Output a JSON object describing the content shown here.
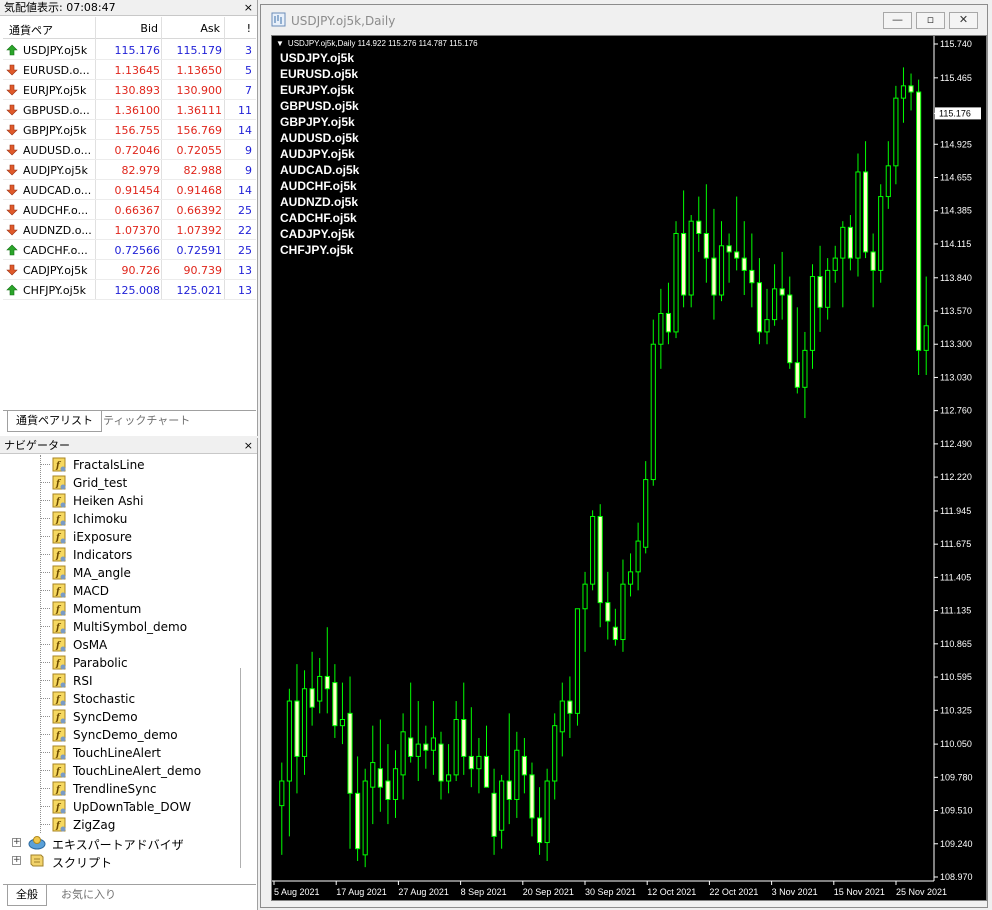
{
  "market_watch": {
    "title": "気配値表示: 07:08:47",
    "columns": {
      "symbol": "通貨ペア",
      "bid": "Bid",
      "ask": "Ask",
      "spread": "!"
    },
    "rows": [
      {
        "symbol": "USDJPY.oj5k",
        "bid": "115.176",
        "ask": "115.179",
        "spread": "3",
        "dir": "up"
      },
      {
        "symbol": "EURUSD.o...",
        "bid": "1.13645",
        "ask": "1.13650",
        "spread": "5",
        "dir": "down"
      },
      {
        "symbol": "EURJPY.oj5k",
        "bid": "130.893",
        "ask": "130.900",
        "spread": "7",
        "dir": "down"
      },
      {
        "symbol": "GBPUSD.o...",
        "bid": "1.36100",
        "ask": "1.36111",
        "spread": "11",
        "dir": "down"
      },
      {
        "symbol": "GBPJPY.oj5k",
        "bid": "156.755",
        "ask": "156.769",
        "spread": "14",
        "dir": "down"
      },
      {
        "symbol": "AUDUSD.o...",
        "bid": "0.72046",
        "ask": "0.72055",
        "spread": "9",
        "dir": "down"
      },
      {
        "symbol": "AUDJPY.oj5k",
        "bid": "82.979",
        "ask": "82.988",
        "spread": "9",
        "dir": "down"
      },
      {
        "symbol": "AUDCAD.o...",
        "bid": "0.91454",
        "ask": "0.91468",
        "spread": "14",
        "dir": "down"
      },
      {
        "symbol": "AUDCHF.o...",
        "bid": "0.66367",
        "ask": "0.66392",
        "spread": "25",
        "dir": "down"
      },
      {
        "symbol": "AUDNZD.o...",
        "bid": "1.07370",
        "ask": "1.07392",
        "spread": "22",
        "dir": "down"
      },
      {
        "symbol": "CADCHF.o...",
        "bid": "0.72566",
        "ask": "0.72591",
        "spread": "25",
        "dir": "up"
      },
      {
        "symbol": "CADJPY.oj5k",
        "bid": "90.726",
        "ask": "90.739",
        "spread": "13",
        "dir": "down"
      },
      {
        "symbol": "CHFJPY.oj5k",
        "bid": "125.008",
        "ask": "125.021",
        "spread": "13",
        "dir": "up"
      }
    ],
    "tabs": [
      "通貨ペアリスト",
      "ティックチャート"
    ]
  },
  "navigator": {
    "title": "ナビゲーター",
    "indicators": [
      "FractalsLine",
      "Grid_test",
      "Heiken Ashi",
      "Ichimoku",
      "iExposure",
      "Indicators",
      "MA_angle",
      "MACD",
      "Momentum",
      "MultiSymbol_demo",
      "OsMA",
      "Parabolic",
      "RSI",
      "Stochastic",
      "SyncDemo",
      "SyncDemo_demo",
      "TouchLineAlert",
      "TouchLineAlert_demo",
      "TrendlineSync",
      "UpDownTable_DOW",
      "ZigZag"
    ],
    "folders": [
      "エキスパートアドバイザ",
      "スクリプト"
    ],
    "tabs": [
      "全般",
      "お気に入り"
    ]
  },
  "chart_window": {
    "title": "USDJPY.oj5k,Daily",
    "info_line": "USDJPY.oj5k,Daily  114.922 115.276 114.787 115.176",
    "symbol_overlay": [
      "USDJPY.oj5k",
      "EURUSD.oj5k",
      "EURJPY.oj5k",
      "GBPUSD.oj5k",
      "GBPJPY.oj5k",
      "AUDUSD.oj5k",
      "AUDJPY.oj5k",
      "AUDCAD.oj5k",
      "AUDCHF.oj5k",
      "AUDNZD.oj5k",
      "CADCHF.oj5k",
      "CADJPY.oj5k",
      "CHFJPY.oj5k"
    ],
    "last_price": "115.176"
  },
  "chart_data": {
    "type": "candlestick",
    "symbol": "USDJPY.oj5k",
    "timeframe": "Daily",
    "y_ticks": [
      "115.740",
      "115.465",
      "115.176",
      "114.925",
      "114.655",
      "114.385",
      "114.115",
      "113.840",
      "113.570",
      "113.300",
      "113.030",
      "112.760",
      "112.490",
      "112.220",
      "111.945",
      "111.675",
      "111.405",
      "111.135",
      "110.865",
      "110.595",
      "110.325",
      "110.050",
      "109.780",
      "109.510",
      "109.240",
      "108.970"
    ],
    "x_ticks": [
      "5 Aug 2021",
      "17 Aug 2021",
      "27 Aug 2021",
      "8 Sep 2021",
      "20 Sep 2021",
      "30 Sep 2021",
      "12 Oct 2021",
      "22 Oct 2021",
      "3 Nov 2021",
      "15 Nov 2021",
      "25 Nov 2021"
    ],
    "ylim": [
      108.97,
      115.74
    ],
    "up_color": "#00ff00",
    "body_up_fill": "#000000",
    "body_down_fill": "#ffffc8",
    "candles": [
      [
        109.55,
        109.9,
        109.15,
        109.75
      ],
      [
        109.75,
        110.5,
        109.3,
        110.4
      ],
      [
        110.4,
        110.7,
        109.65,
        109.95
      ],
      [
        109.95,
        110.65,
        109.8,
        110.5
      ],
      [
        110.5,
        110.8,
        110.2,
        110.35
      ],
      [
        110.4,
        110.75,
        110.3,
        110.6
      ],
      [
        110.6,
        111.0,
        110.3,
        110.5
      ],
      [
        110.55,
        110.7,
        110.1,
        110.2
      ],
      [
        110.2,
        110.55,
        110.05,
        110.25
      ],
      [
        110.3,
        110.6,
        109.2,
        109.65
      ],
      [
        109.65,
        109.95,
        109.1,
        109.2
      ],
      [
        109.15,
        109.85,
        109.05,
        109.75
      ],
      [
        109.7,
        110.2,
        109.4,
        109.9
      ],
      [
        109.85,
        110.25,
        109.5,
        109.7
      ],
      [
        109.75,
        110.05,
        109.4,
        109.6
      ],
      [
        109.6,
        110.0,
        109.45,
        109.85
      ],
      [
        109.8,
        110.3,
        109.6,
        110.15
      ],
      [
        110.1,
        110.55,
        109.9,
        109.95
      ],
      [
        109.95,
        110.4,
        109.75,
        110.05
      ],
      [
        110.05,
        110.2,
        109.85,
        110.0
      ],
      [
        110.0,
        110.4,
        109.8,
        110.1
      ],
      [
        110.05,
        110.15,
        109.6,
        109.75
      ],
      [
        109.75,
        110.05,
        109.65,
        109.8
      ],
      [
        109.8,
        110.4,
        109.75,
        110.25
      ],
      [
        110.25,
        110.55,
        109.8,
        109.95
      ],
      [
        109.95,
        110.35,
        109.7,
        109.85
      ],
      [
        109.85,
        110.1,
        109.65,
        109.95
      ],
      [
        109.95,
        110.2,
        109.7,
        109.7
      ],
      [
        109.65,
        109.85,
        109.15,
        109.3
      ],
      [
        109.35,
        109.8,
        109.2,
        109.75
      ],
      [
        109.75,
        110.3,
        109.4,
        109.6
      ],
      [
        109.6,
        110.15,
        109.45,
        110.0
      ],
      [
        109.95,
        110.1,
        109.65,
        109.8
      ],
      [
        109.8,
        109.9,
        109.3,
        109.45
      ],
      [
        109.45,
        109.7,
        109.15,
        109.25
      ],
      [
        109.25,
        109.85,
        109.1,
        109.75
      ],
      [
        109.75,
        110.3,
        109.6,
        110.2
      ],
      [
        110.15,
        110.55,
        109.95,
        110.4
      ],
      [
        110.4,
        110.6,
        110.1,
        110.3
      ],
      [
        110.3,
        111.15,
        110.2,
        111.15
      ],
      [
        111.15,
        111.45,
        110.8,
        111.35
      ],
      [
        111.35,
        111.95,
        111.3,
        111.9
      ],
      [
        111.9,
        112.0,
        111.0,
        111.2
      ],
      [
        111.2,
        111.45,
        110.9,
        111.05
      ],
      [
        111.0,
        111.15,
        110.85,
        110.9
      ],
      [
        110.9,
        111.55,
        110.8,
        111.35
      ],
      [
        111.35,
        111.6,
        111.25,
        111.45
      ],
      [
        111.45,
        111.85,
        111.3,
        111.7
      ],
      [
        111.65,
        112.35,
        111.6,
        112.2
      ],
      [
        112.2,
        113.5,
        112.15,
        113.3
      ],
      [
        113.3,
        113.75,
        113.1,
        113.55
      ],
      [
        113.55,
        113.8,
        113.3,
        113.4
      ],
      [
        113.4,
        114.3,
        113.35,
        114.2
      ],
      [
        114.2,
        114.55,
        113.6,
        113.7
      ],
      [
        113.7,
        114.35,
        113.6,
        114.3
      ],
      [
        114.3,
        114.5,
        114.05,
        114.2
      ],
      [
        114.2,
        114.6,
        113.8,
        114.0
      ],
      [
        114.0,
        114.4,
        113.5,
        113.7
      ],
      [
        113.7,
        114.3,
        113.65,
        114.1
      ],
      [
        114.1,
        114.2,
        113.8,
        114.05
      ],
      [
        114.05,
        114.5,
        113.9,
        114.0
      ],
      [
        114.0,
        114.3,
        113.7,
        113.9
      ],
      [
        113.9,
        114.2,
        113.6,
        113.8
      ],
      [
        113.8,
        114.0,
        113.3,
        113.4
      ],
      [
        113.4,
        113.75,
        113.3,
        113.5
      ],
      [
        113.5,
        113.95,
        113.45,
        113.75
      ],
      [
        113.75,
        114.05,
        113.5,
        113.7
      ],
      [
        113.7,
        113.85,
        113.1,
        113.15
      ],
      [
        113.15,
        113.6,
        112.9,
        112.95
      ],
      [
        112.95,
        113.4,
        112.7,
        113.25
      ],
      [
        113.25,
        113.95,
        113.1,
        113.85
      ],
      [
        113.85,
        114.1,
        113.4,
        113.6
      ],
      [
        113.6,
        114.0,
        113.5,
        113.9
      ],
      [
        113.9,
        114.1,
        113.8,
        114.0
      ],
      [
        114.0,
        114.3,
        113.6,
        114.25
      ],
      [
        114.25,
        114.35,
        113.9,
        114.0
      ],
      [
        114.0,
        114.85,
        113.85,
        114.7
      ],
      [
        114.7,
        114.95,
        114.0,
        114.05
      ],
      [
        114.05,
        114.2,
        113.6,
        113.9
      ],
      [
        113.9,
        114.6,
        113.8,
        114.5
      ],
      [
        114.5,
        114.95,
        114.4,
        114.75
      ],
      [
        114.75,
        115.4,
        114.6,
        115.3
      ],
      [
        115.3,
        115.55,
        115.1,
        115.4
      ],
      [
        115.4,
        115.5,
        115.2,
        115.35
      ],
      [
        115.35,
        115.45,
        113.05,
        113.25
      ],
      [
        113.25,
        113.85,
        113.05,
        113.45
      ]
    ]
  }
}
